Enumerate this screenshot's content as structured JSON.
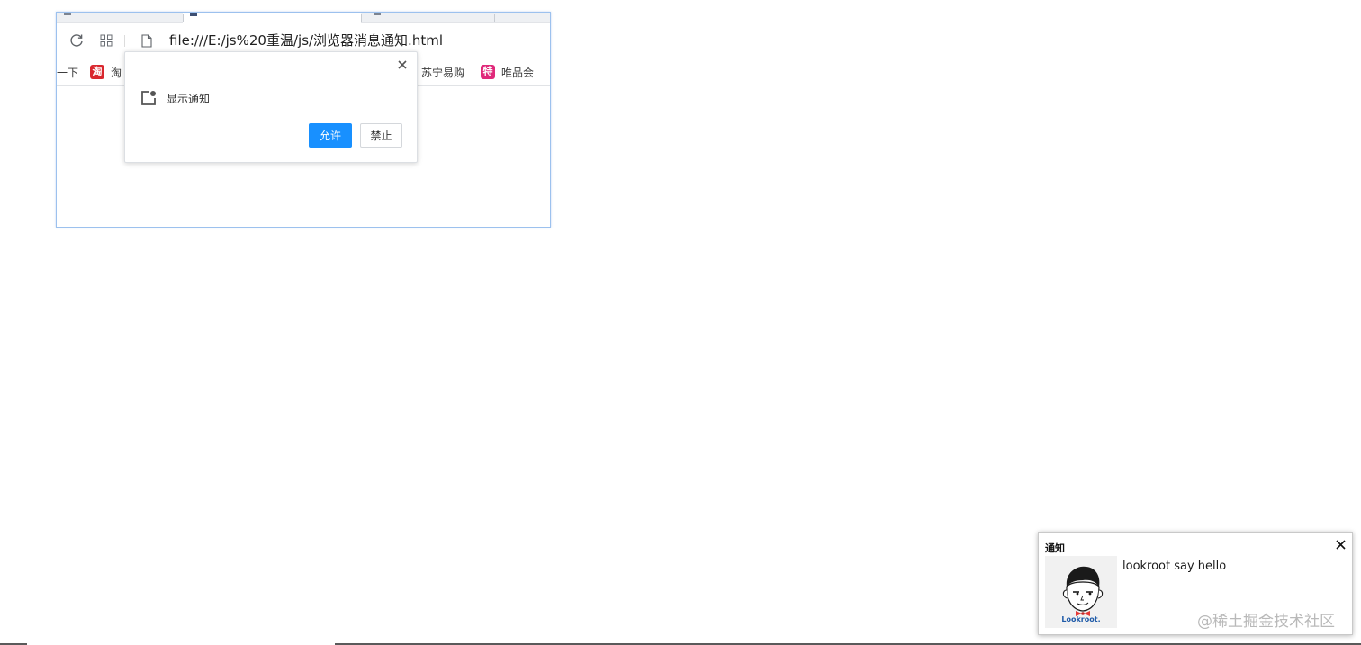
{
  "browser": {
    "address_bar": {
      "url": "file:///E:/js%20重温/js/浏览器消息通知.html",
      "reload_icon": "reload-icon",
      "apps_icon": "apps-grid-icon",
      "page_icon": "file-page-icon"
    },
    "bookmarks": [
      {
        "label": "一下",
        "icon": ""
      },
      {
        "label": "淘",
        "icon": "淘",
        "color": "#d9272e"
      },
      {
        "label": "苏宁易购",
        "icon": "",
        "color": "#f5a623"
      },
      {
        "label": "唯品会",
        "icon": "特",
        "color": "#e0297a"
      }
    ]
  },
  "permission_popup": {
    "label": "显示通知",
    "allow_label": "允许",
    "deny_label": "禁止",
    "allow_color": "#1890ff",
    "icon": "notification-bell-icon"
  },
  "toast": {
    "title": "通知",
    "message": "lookroot say hello",
    "avatar_caption": "Lookroot."
  },
  "watermark": "@稀土掘金技术社区"
}
